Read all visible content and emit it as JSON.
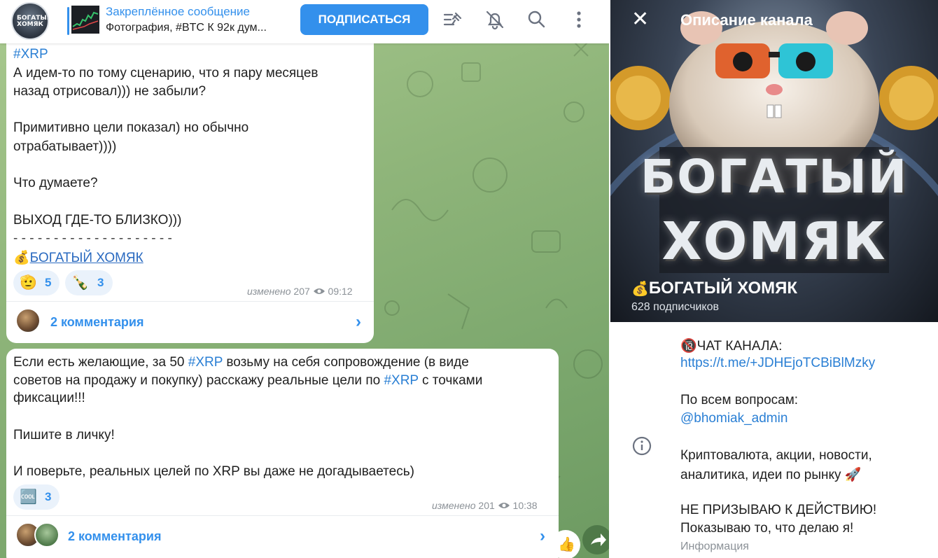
{
  "header": {
    "pinned_title": "Закреплённое сообщение",
    "pinned_text": "Фотография, #BTC К 92к дум...",
    "subscribe_label": "ПОДПИСАТЬСЯ"
  },
  "message1": {
    "hashtag": "#XRP",
    "lines": [
      "А идем-то по тому сценарию, что я пару месяцев",
      "назад отрисовал))) не забыли?",
      "Примитивно цели показал) но обычно",
      "отрабатывает))))",
      "Что думаете?",
      "ВЫХОД ГДЕ-ТО БЛИЗКО)))",
      "- - - - - - - - - - - - - - - - - - - -"
    ],
    "signature": "БОГАТЫЙ ХОМЯК",
    "reactions": [
      {
        "emoji": "🫡",
        "count": "5"
      },
      {
        "emoji": "🍾",
        "count": "3"
      }
    ],
    "edited": "изменено",
    "views": "207",
    "time": "09:12",
    "comments": "2 комментария"
  },
  "message2": {
    "line1_a": "Если есть желающие, за 50 ",
    "line1_tag": "#XRP",
    "line1_b": " возьму на себя сопровождение (в виде",
    "line2_a": "советов на продажу и покупку) расскажу реальные цели по ",
    "line2_tag": "#XRP",
    "line2_b": " с точками",
    "line3": "фиксации!!!",
    "line4": "Пишите в личку!",
    "line5": "И поверьте, реальных целей по XRP вы даже не догадываетесь)",
    "reaction": {
      "emoji": "🆒",
      "count": "3"
    },
    "edited": "изменено",
    "views": "201",
    "time": "10:38",
    "comments": "2 комментария"
  },
  "panel": {
    "title": "Описание канала",
    "banner_word1": "БОГАТЫЙ",
    "banner_word2": "ХОМЯК",
    "channel_name": "БОГАТЫЙ ХОМЯК",
    "subscribers": "628 подписчиков",
    "chat_label": "🔞ЧАТ КАНАЛА:",
    "chat_link": "https://t.me/+JDHEjoTCBiBlMzky",
    "questions_label": "По всем вопросам:",
    "admin": "@bhomiak_admin",
    "about1": "Криптовалюта, акции, новости,",
    "about2": "аналитика, идеи по рынку 🚀",
    "disclaimer1": "НЕ ПРИЗЫВАЮ К ДЕЙСТВИЮ!",
    "disclaimer2": "Показываю то, что делаю я!",
    "caption": "Информация"
  },
  "colors": {
    "accent": "#3390ec",
    "chat_bg": "#8fb57a",
    "bubble": "#ffffff"
  }
}
